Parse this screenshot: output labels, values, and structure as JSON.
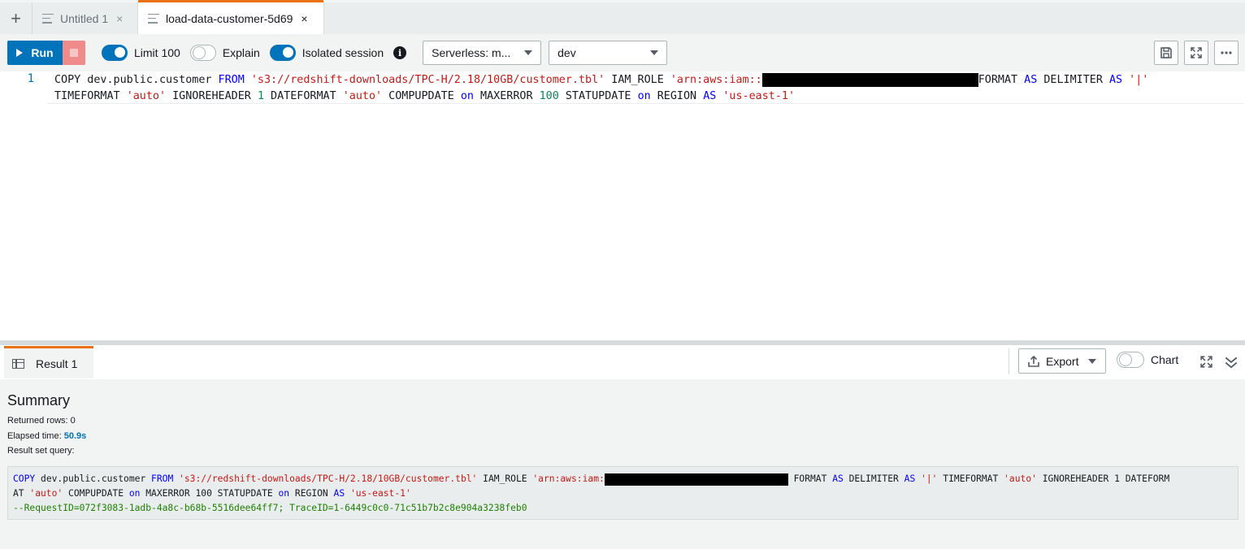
{
  "tabs": {
    "add_label": "+",
    "items": [
      {
        "label": "Untitled 1",
        "close": "×"
      },
      {
        "label": "load-data-customer-5d69",
        "close": "×"
      }
    ]
  },
  "toolbar": {
    "run_label": "Run",
    "limit_label": "Limit 100",
    "explain_label": "Explain",
    "isolated_label": "Isolated session",
    "info_glyph": "i",
    "workgroup_value": "Serverless: m...",
    "database_value": "dev",
    "toggles": {
      "limit": true,
      "explain": false,
      "isolated": true
    }
  },
  "editor": {
    "line_number": "1",
    "line1": {
      "t1": "COPY dev.public.customer ",
      "t2": "FROM",
      "t3": " ",
      "t4": "'s3://redshift-downloads/TPC-H/2.18/10GB/customer.tbl'",
      "t5": " IAM_ROLE ",
      "t6": "'arn:aws:iam::",
      "t7": "FORMAT ",
      "t8": "AS",
      "t9": " DELIMITER ",
      "t10": "AS",
      "t11": " ",
      "t12": "'|'"
    },
    "line2": {
      "t1": "TIMEFORMAT ",
      "t2": "'auto'",
      "t3": " IGNOREHEADER ",
      "t4": "1",
      "t5": " DATEFORMAT ",
      "t6": "'auto'",
      "t7": " COMPUPDATE ",
      "t8": "on",
      "t9": " MAXERROR ",
      "t10": "100",
      "t11": " STATUPDATE ",
      "t12": "on",
      "t13": " REGION ",
      "t14": "AS",
      "t15": " ",
      "t16": "'us-east-1'"
    }
  },
  "results": {
    "tab_label": "Result 1",
    "export_label": "Export",
    "chart_label": "Chart",
    "chart_toggle": false,
    "summary_title": "Summary",
    "returned_rows": "Returned rows: 0",
    "elapsed_label": "Elapsed time: ",
    "elapsed_value": "50.9s",
    "result_set_label": "Result set query:",
    "query": {
      "l1": {
        "t1": "COPY",
        "t2": " dev.public.customer ",
        "t3": "FROM",
        "t4": " ",
        "t5": "'s3://redshift-downloads/TPC-H/2.18/10GB/customer.tbl'",
        "t6": " IAM_ROLE ",
        "t7": "'arn:aws:iam:",
        "t8": " FORMAT ",
        "t9": "AS",
        "t10": " DELIMITER ",
        "t11": "AS",
        "t12": " ",
        "t13": "'|'",
        "t14": " TIMEFORMAT ",
        "t15": "'auto'",
        "t16": " IGNOREHEADER 1 DATEFORM"
      },
      "l2": {
        "t1": "AT ",
        "t2": "'auto'",
        "t3": " COMPUPDATE ",
        "t4": "on",
        "t5": " MAXERROR 100 STATUPDATE ",
        "t6": "on",
        "t7": " REGION ",
        "t8": "AS",
        "t9": " ",
        "t10": "'us-east-1'"
      },
      "l3": "--RequestID=072f3083-1adb-4a8c-b68b-5516dee64ff7; TraceID=1-6449c0c0-71c51b7b2c8e904a3238feb0"
    }
  },
  "colors": {
    "accent": "#0073bb",
    "tab_active": "#ec7211",
    "keyword": "#0000ff",
    "string": "#c41a16",
    "number": "#098658",
    "comment": "#1d8102"
  }
}
